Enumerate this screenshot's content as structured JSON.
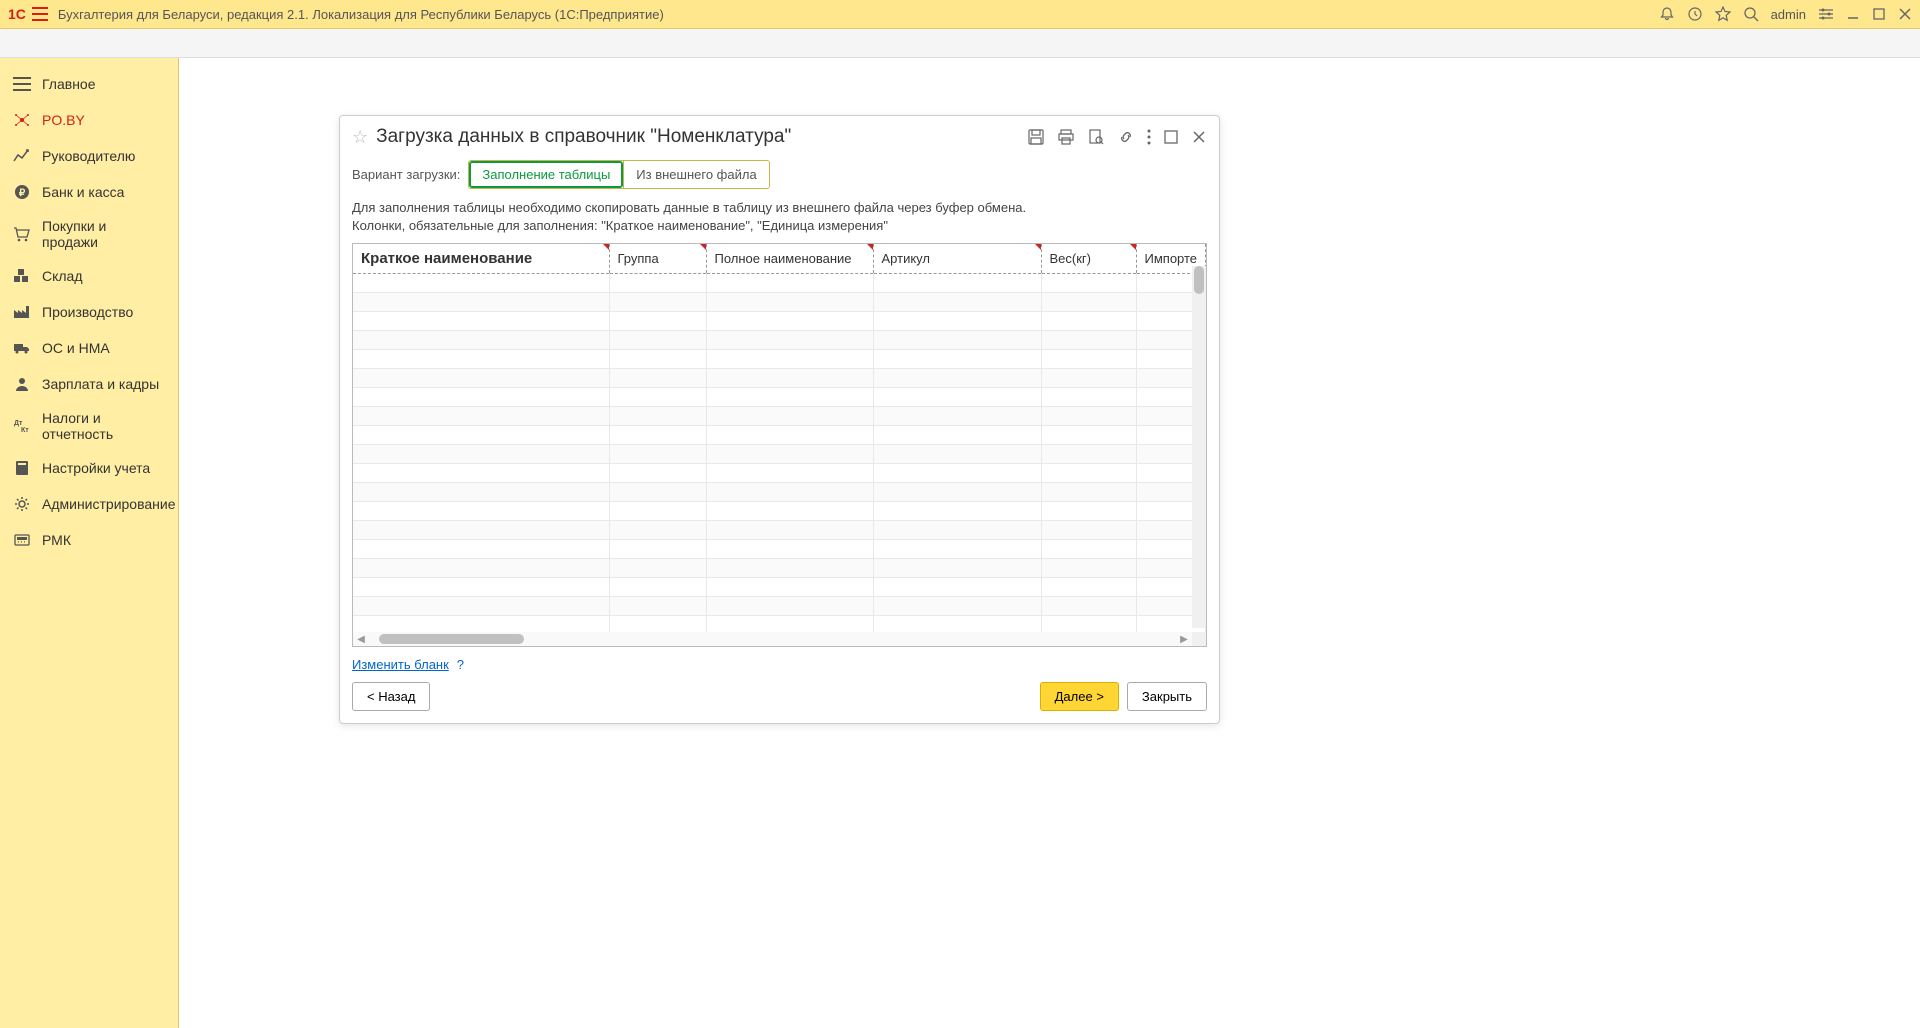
{
  "titlebar": {
    "app_title": "Бухгалтерия для Беларуси, редакция 2.1. Локализация для Республики Беларусь   (1С:Предприятие)",
    "username": "admin"
  },
  "sidebar": {
    "items": [
      {
        "label": "Главное"
      },
      {
        "label": "PO.BY"
      },
      {
        "label": "Руководителю"
      },
      {
        "label": "Банк и касса"
      },
      {
        "label": "Покупки и продажи"
      },
      {
        "label": "Склад"
      },
      {
        "label": "Производство"
      },
      {
        "label": "ОС и НМА"
      },
      {
        "label": "Зарплата и кадры"
      },
      {
        "label": "Налоги и отчетность"
      },
      {
        "label": "Настройки учета"
      },
      {
        "label": "Администрирование"
      },
      {
        "label": "РМК"
      }
    ]
  },
  "form": {
    "title": "Загрузка данных в справочник \"Номенклатура\"",
    "variant_label": "Вариант загрузки:",
    "tab_fill": "Заполнение таблицы",
    "tab_file": "Из внешнего файла",
    "instructions_line1": "Для заполнения таблицы необходимо скопировать данные в таблицу из внешнего файла через буфер обмена.",
    "instructions_line2": "Колонки, обязательные для заполнения: \"Краткое наименование\", \"Единица измерения\"",
    "columns": [
      {
        "label": "Краткое наименование"
      },
      {
        "label": "Группа"
      },
      {
        "label": "Полное наименование"
      },
      {
        "label": "Артикул"
      },
      {
        "label": "Вес(кг)"
      },
      {
        "label": "Импорте"
      }
    ],
    "change_blank": "Изменить бланк",
    "help": "?",
    "back": "< Назад",
    "next": "Далее >",
    "close": "Закрыть"
  }
}
